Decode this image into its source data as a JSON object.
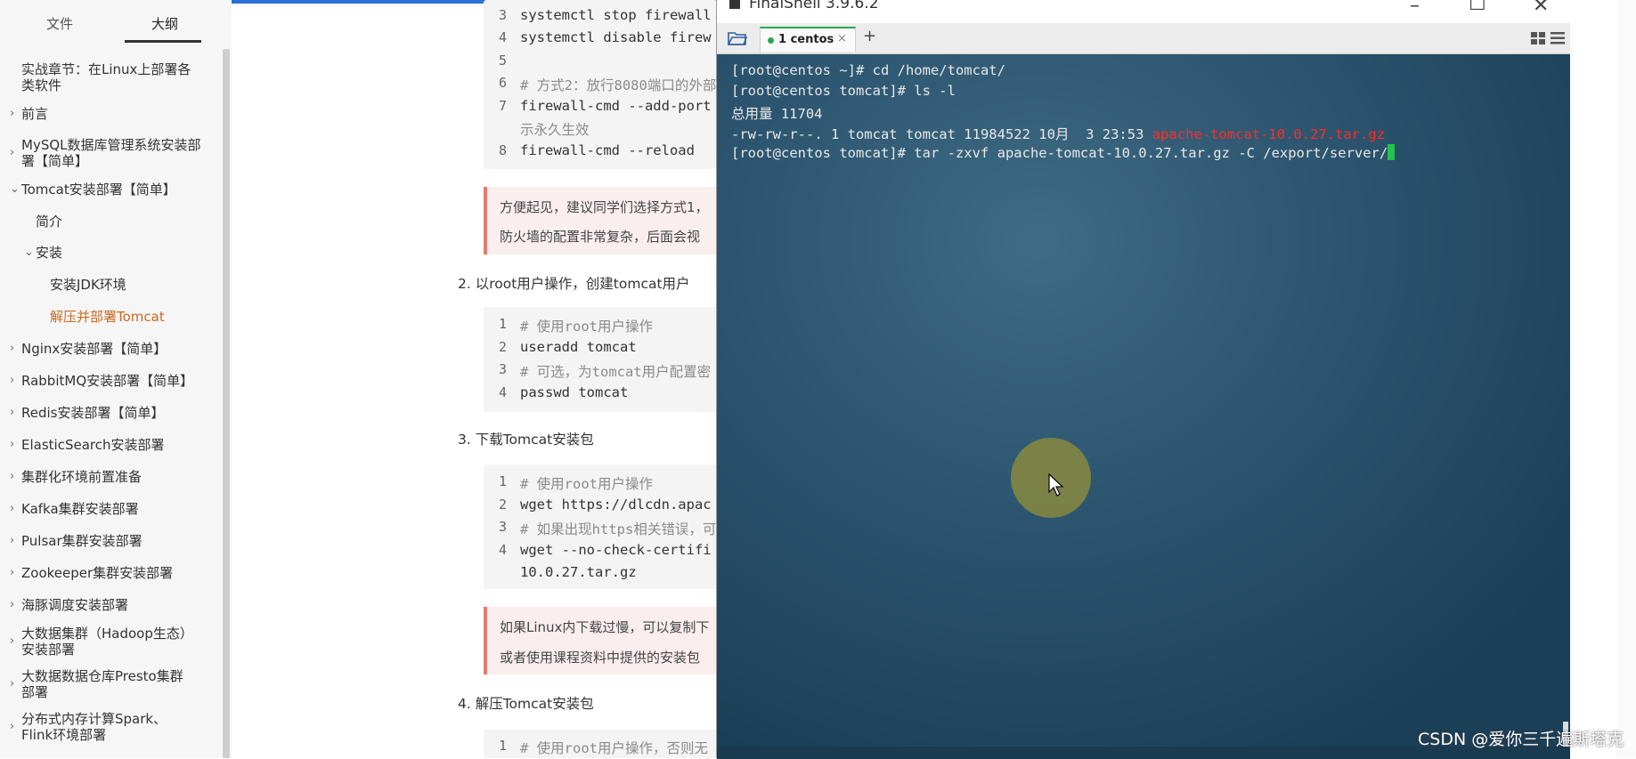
{
  "sidebar": {
    "tabs": [
      "文件",
      "大纲"
    ],
    "items": [
      {
        "label": "实战章节：在Linux上部署各",
        "label2": "类软件",
        "chevron": ""
      },
      {
        "label": "前言",
        "chevron": "›"
      },
      {
        "label": "MySQL数据库管理系统安装部",
        "label2": "署【简单】",
        "chevron": "›"
      },
      {
        "label": "Tomcat安装部署【简单】",
        "chevron": "⌄"
      },
      {
        "label": "简介",
        "chevron": ""
      },
      {
        "label": "安装",
        "chevron": "⌄"
      },
      {
        "label": "安装JDK环境",
        "chevron": ""
      },
      {
        "label": "解压并部署Tomcat",
        "chevron": "",
        "active": true
      },
      {
        "label": "Nginx安装部署【简单】",
        "chevron": "›"
      },
      {
        "label": "RabbitMQ安装部署【简单】",
        "chevron": "›"
      },
      {
        "label": "Redis安装部署【简单】",
        "chevron": "›"
      },
      {
        "label": "ElasticSearch安装部署",
        "chevron": "›"
      },
      {
        "label": "集群化环境前置准备",
        "chevron": "›"
      },
      {
        "label": "Kafka集群安装部署",
        "chevron": "›"
      },
      {
        "label": "Pulsar集群安装部署",
        "chevron": "›"
      },
      {
        "label": "Zookeeper集群安装部署",
        "chevron": "›"
      },
      {
        "label": "海豚调度安装部署",
        "chevron": "›"
      },
      {
        "label": "大数据集群（Hadoop生态）",
        "label2": "安装部署",
        "chevron": "›"
      },
      {
        "label": "大数据数据仓库Presto集群",
        "label2": "部署",
        "chevron": "›"
      },
      {
        "label": "分布式内存计算Spark、",
        "label2": "Flink环境部署",
        "chevron": "›"
      }
    ]
  },
  "document": {
    "block1": {
      "lines": [
        {
          "num": "3",
          "text": "systemctl stop firewall"
        },
        {
          "num": "4",
          "text": "systemctl disable firew"
        },
        {
          "num": "5",
          "text": ""
        },
        {
          "num": "6",
          "text": "# 方式2：放行8080端口的外部"
        },
        {
          "num": "7",
          "text": "firewall-cmd --add-port"
        },
        {
          "num": "",
          "text": "示永久生效"
        },
        {
          "num": "8",
          "text": "firewall-cmd --reload"
        }
      ]
    },
    "note1": [
      "方便起见，建议同学们选择方式1，",
      "防火墙的配置非常复杂，后面会视"
    ],
    "step2": "2. 以root用户操作，创建tomcat用户",
    "block2": {
      "lines": [
        {
          "num": "1",
          "text": "# 使用root用户操作"
        },
        {
          "num": "2",
          "text": "useradd tomcat"
        },
        {
          "num": "3",
          "text": "# 可选，为tomcat用户配置密"
        },
        {
          "num": "4",
          "text": "passwd tomcat"
        }
      ]
    },
    "step3": "3. 下载Tomcat安装包",
    "block3": {
      "lines": [
        {
          "num": "1",
          "text": "# 使用root用户操作"
        },
        {
          "num": "2",
          "text": "wget https://dlcdn.apac"
        },
        {
          "num": "3",
          "text": "# 如果出现https相关错误，可"
        },
        {
          "num": "4",
          "text": "wget --no-check-certifi"
        },
        {
          "num": "",
          "text": "10.0.27.tar.gz"
        }
      ]
    },
    "note2": [
      "如果Linux内下载过慢，可以复制下",
      "或者使用课程资料中提供的安装包"
    ],
    "step4": "4. 解压Tomcat安装包",
    "block4": {
      "lines": [
        {
          "num": "1",
          "text": "# 使用root用户操作，否则无"
        }
      ]
    }
  },
  "finalshell": {
    "title": "FinalShell 3.9.6.2",
    "tab_label": "1 centos",
    "tab_close": "×",
    "add_tab": "+",
    "terminal": {
      "lines": [
        "[root@centos ~]# cd /home/tomcat/",
        "[root@centos tomcat]# ls -l",
        "总用量 11704",
        "-rw-rw-r--. 1 tomcat tomcat 11984522 10月  3 23:53 ",
        "[root@centos tomcat]# tar -zxvf apache-tomcat-10.0.27.tar.gz -C /export/server/"
      ],
      "highlight_file": "apache-tomcat-10.0.27.tar.gz",
      "highlight_color": "#ff2b2b",
      "prompt_cursor_color": "#27c24c"
    }
  },
  "watermark": "CSDN @爱你三千遍斯塔克",
  "colors": {
    "accent_active": "#c96a1f",
    "note_border": "#e67a6e",
    "tab_active": "#2aa84a"
  }
}
